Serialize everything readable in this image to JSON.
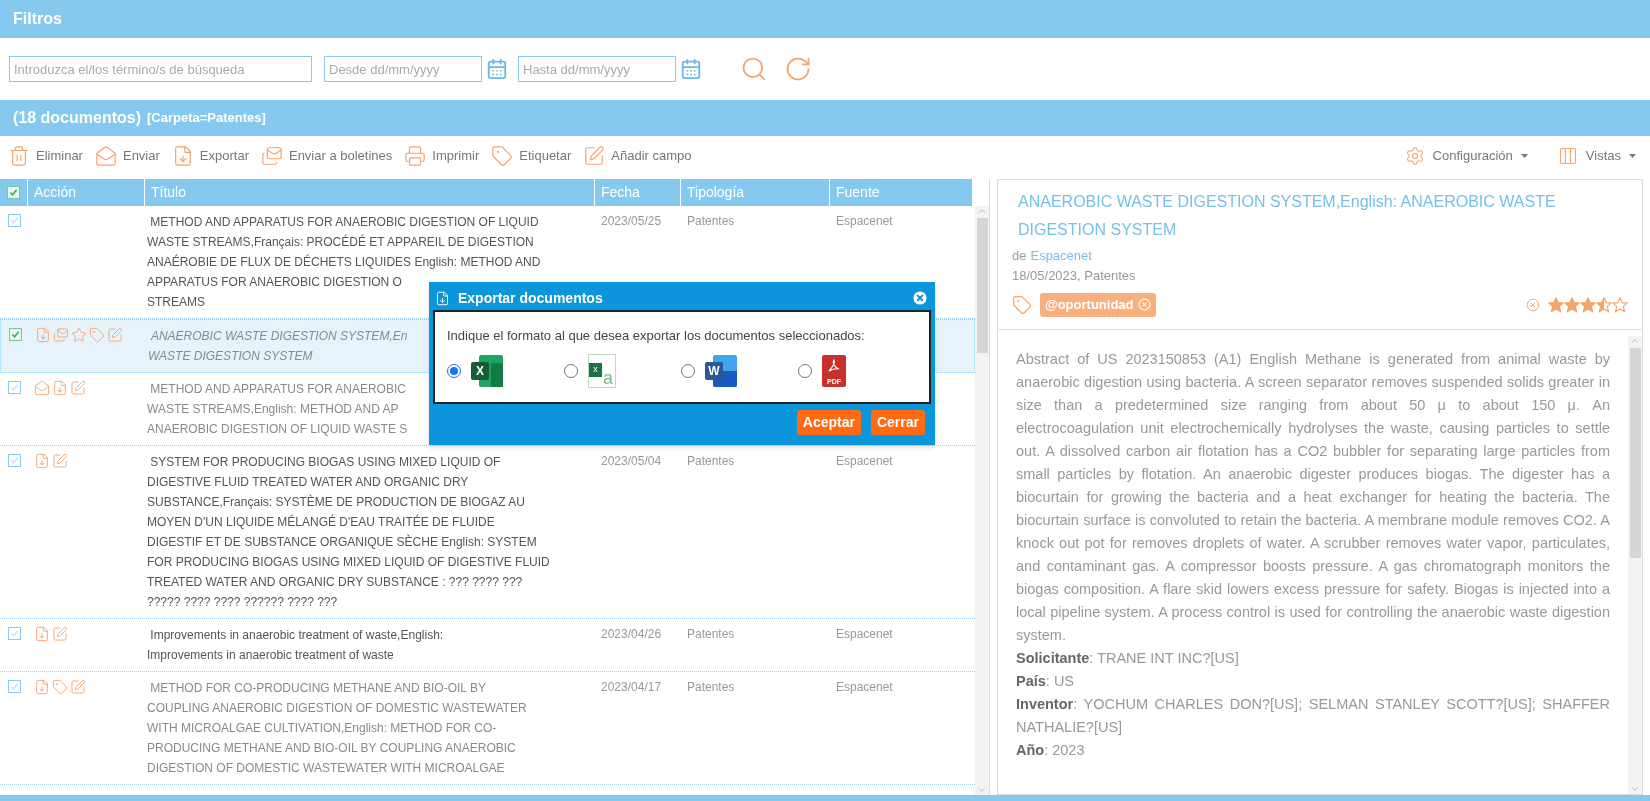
{
  "filters": {
    "title": "Filtros",
    "search": {
      "placeholder": "Introduzca el/los término/s de búsqueda"
    },
    "from": {
      "placeholder": "Desde dd/mm/yyyy"
    },
    "to": {
      "placeholder": "Hasta dd/mm/yyyy"
    }
  },
  "results_bar": {
    "count": "(18 documentos)",
    "folder": "[Carpeta=Patentes]"
  },
  "toolbar": {
    "actions": [
      {
        "kind": "delete",
        "label": "Eliminar"
      },
      {
        "kind": "send",
        "label": "Enviar"
      },
      {
        "kind": "export",
        "label": "Exportar"
      },
      {
        "kind": "newsletter",
        "label": "Enviar a boletines"
      },
      {
        "kind": "print",
        "label": "Imprimir"
      },
      {
        "kind": "tag",
        "label": "Etiquetar"
      },
      {
        "kind": "field",
        "label": "Añadir campo"
      }
    ],
    "menus": [
      {
        "kind": "settings",
        "label": "Configuración"
      },
      {
        "kind": "views",
        "label": "Vistas"
      }
    ]
  },
  "table": {
    "header_checked": true,
    "columns": [
      "Acción",
      "Título",
      "Fecha",
      "Tipología",
      "Fuente"
    ],
    "rows": [
      {
        "checked": false,
        "selected": false,
        "read": false,
        "title_lines": [
          " METHOD AND APPARATUS FOR ANAEROBIC DIGESTION OF LIQUID",
          "WASTE STREAMS,Français: PROCÉDÉ ET APPAREIL DE DIGESTION",
          "ANAÉROBIE DE FLUX DE DÉCHETS LIQUIDES English: METHOD AND",
          "APPARATUS FOR ANAEROBIC DIGESTION O",
          "STREAMS"
        ],
        "date": "2023/05/25",
        "type": "Patentes",
        "source": "Espacenet"
      },
      {
        "checked": true,
        "selected": true,
        "read": true,
        "actions": [
          {
            "kind": "export"
          },
          {
            "kind": "newsletter"
          },
          {
            "kind": "star"
          },
          {
            "kind": "tag"
          },
          {
            "kind": "edit"
          }
        ],
        "title_lines": [
          " ANAEROBIC WASTE DIGESTION SYSTEM,En",
          "WASTE DIGESTION SYSTEM"
        ]
      },
      {
        "checked": false,
        "selected": false,
        "read": true,
        "actions": [
          {
            "kind": "mail"
          },
          {
            "kind": "export"
          },
          {
            "kind": "edit"
          }
        ],
        "title_lines": [
          " METHOD AND APPARATUS FOR ANAEROBIC",
          "WASTE STREAMS,English: METHOD AND AP",
          "ANAEROBIC DIGESTION OF LIQUID WASTE S"
        ]
      },
      {
        "checked": false,
        "selected": false,
        "read": false,
        "actions": [
          {
            "kind": "export"
          },
          {
            "kind": "edit"
          }
        ],
        "title_lines": [
          " SYSTEM FOR PRODUCING BIOGAS USING MIXED LIQUID OF",
          "DIGESTIVE FLUID TREATED WATER AND ORGANIC DRY",
          "SUBSTANCE,Français: SYSTÈME DE PRODUCTION DE BIOGAZ AU",
          "MOYEN D'UN LIQUIDE MÉLANGÉ D'EAU TRAITÉE DE FLUIDE",
          "DIGESTIF ET DE SUBSTANCE ORGANIQUE SÈCHE English: SYSTEM",
          "FOR PRODUCING BIOGAS USING MIXED LIQUID OF DIGESTIVE FLUID",
          "TREATED WATER AND ORGANIC DRY SUBSTANCE : ??? ???? ???",
          "????? ???? ???? ?????? ???? ???"
        ],
        "date": "2023/05/04",
        "type": "Patentes",
        "source": "Espacenet"
      },
      {
        "checked": false,
        "selected": false,
        "read": false,
        "actions": [
          {
            "kind": "export"
          },
          {
            "kind": "edit"
          }
        ],
        "title_lines": [
          " Improvements in anaerobic treatment of waste,English:",
          "Improvements in anaerobic treatment of waste"
        ],
        "date": "2023/04/26",
        "type": "Patentes",
        "source": "Espacenet"
      },
      {
        "checked": false,
        "selected": false,
        "read": true,
        "actions": [
          {
            "kind": "export"
          },
          {
            "kind": "tag"
          },
          {
            "kind": "edit"
          }
        ],
        "title_lines": [
          " METHOD FOR CO-PRODUCING METHANE AND BIO-OIL BY",
          "COUPLING ANAEROBIC DIGESTION OF DOMESTIC WASTEWATER",
          "WITH MICROALGAE CULTIVATION,English: METHOD FOR CO-",
          "PRODUCING METHANE AND BIO-OIL BY COUPLING ANAEROBIC",
          "DIGESTION OF DOMESTIC WASTEWATER WITH MICROALGAE"
        ],
        "date": "2023/04/17",
        "type": "Patentes",
        "source": "Espacenet"
      }
    ]
  },
  "detail": {
    "title": "ANAEROBIC WASTE DIGESTION SYSTEM,English: ANAEROBIC WASTE DIGESTION SYSTEM",
    "from_label": "de",
    "source": "Espacenet",
    "meta": "18/05/2023, Patentes",
    "tags": [
      {
        "label": "@oportunidad"
      }
    ],
    "stars": 3.5,
    "abstract": "Abstract of  US 2023150853 (A1) English Methane is generated from animal waste by anaerobic digestion using bacteria. A screen separator removes suspended solids greater in size than a predetermined size ranging from about 50 μ to about 150 μ. An electrocoagulation unit electrochemically hydrolyses the waste, causing particles to settle out. A dissolved carbon air flotation has a CO2 bubbler for separating large particles from small particles by flotation. An anaerobic digester produces biogas. The digester has a biocurtain for growing the bacteria and a heat exchanger for heating the bacteria. The biocurtain surface is convoluted to retain the bacteria. A membrane module removes CO2. A knock out pot for removes droplets of water. A scrubber removes water vapor, particulates, and contaminant gas. A compressor boosts pressure. A gas chromatograph monitors the biogas composition. A flare skid lowers excess pressure for safety. Biogas is injected into a local pipeline system. A process control is used for controlling the anaerobic waste digestion system.",
    "fields": [
      "**Solicitante**: TRANE INT INC?[US]",
      "**País**: US",
      "**Inventor**: YOCHUM CHARLES DON?[US];  SELMAN STANLEY SCOTT?[US];  SHAFFER NATHALIE?[US]",
      "**Año**: 2023"
    ]
  },
  "dialog": {
    "title": "Exportar documentos",
    "prompt": "Indique el formato al que desea exportar los documentos seleccionados:",
    "formats": [
      {
        "kind": "excel",
        "glyph": "X",
        "selected": true
      },
      {
        "kind": "csv",
        "glyph": "x",
        "glyph2": "a",
        "selected": false
      },
      {
        "kind": "word",
        "glyph": "W",
        "selected": false
      },
      {
        "kind": "pdf",
        "glyph": "PDF",
        "selected": false
      }
    ],
    "buttons": [
      "Aceptar",
      "Cerrar"
    ]
  }
}
